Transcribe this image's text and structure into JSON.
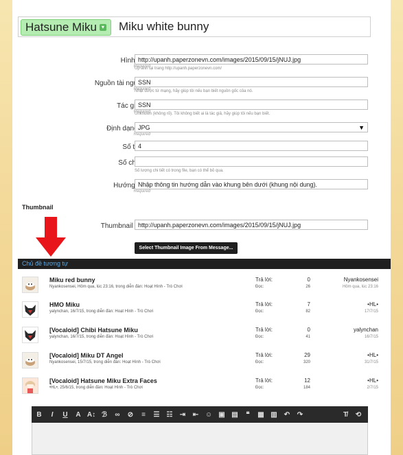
{
  "title_row": {
    "prefix_label": "Hatsune Miku",
    "title_value": "Miku white bunny"
  },
  "form": {
    "image": {
      "label": "Hình ảnh:",
      "required": "Required",
      "value": "http://upanh.paperzonevn.com/images/2015/09/15/jNUJ.jpg",
      "hint": "Up ảnh tại trang http://upanh.paperzonevn.com/"
    },
    "source": {
      "label": "Nguồn tài nguyên:",
      "required": "Required",
      "value": "SSN",
      "hint": "Nhặt được từ mạng, hãy giúp tôi nếu bạn biết nguồn gốc của nó."
    },
    "author": {
      "label": "Tác giả vẽ:",
      "required": "Required",
      "value": "SSN",
      "hint": "Unknown (không rõ). Tôi không biết ai là tác giả, hãy giúp tôi nếu bạn biết."
    },
    "format": {
      "label": "Định dạng file:",
      "required": "Required",
      "value": "JPG"
    },
    "pages": {
      "label": "Số trang:",
      "value": "4"
    },
    "details": {
      "label": "Số chi tiết:",
      "value": "",
      "hint": "Số lượng chi tiết có trong file, bạn có thể bỏ qua."
    },
    "guide": {
      "label": "Hướng dẫn:",
      "required": "Required",
      "value": "Nhập thông tin hướng dẫn vào khung bên dưới (khung nội dung)."
    },
    "thumbnail_heading": "Thumbnail",
    "thumbnail_url": {
      "label": "Thumbnail URL:",
      "value": "http://upanh.paperzonevn.com/images/2015/09/15/jNUJ.jpg"
    },
    "select_thumb_button": "Select Thumbnail Image From Message..."
  },
  "similar": {
    "heading": "Chủ đề tương tự",
    "reply_label": "Trả lời:",
    "views_label": "Đọc:",
    "threads": [
      {
        "title": "Miku red bunny",
        "meta": "Nyankosensei, Hôm qua, lúc 23:16, trong diễn đàn: Hoạt Hình - Trò Chơi",
        "replies": "0",
        "views": "26",
        "user": "Nyankosensei",
        "date": "Hôm qua, lúc 23:16",
        "avatar": "cup-icon"
      },
      {
        "title": "HMO Miku",
        "meta": "yalynchan, 16/7/15, trong diễn đàn: Hoạt Hình - Trò Chơi",
        "replies": "7",
        "views": "82",
        "user": "•HL•",
        "date": "17/7/15",
        "avatar": "wolf-icon"
      },
      {
        "title": "[Vocaloid] Chibi Hatsune Miku",
        "meta": "yalynchan, 16/7/15, trong diễn đàn: Hoạt Hình - Trò Chơi",
        "replies": "0",
        "views": "41",
        "user": "yalynchan",
        "date": "16/7/15",
        "avatar": "wolf-icon"
      },
      {
        "title": "[Vocaloid] Miku DT Angel",
        "meta": "Nyankosensei, 15/7/15, trong diễn đàn: Hoạt Hình - Trò Chơi",
        "replies": "29",
        "views": "320",
        "user": "•HL•",
        "date": "31/7/15",
        "avatar": "cup-icon"
      },
      {
        "title": "[Vocaloid] Hatsune Miku Extra Faces",
        "meta": "•HL•, 25/6/15, trong diễn đàn: Hoạt Hình - Trò Chơi",
        "replies": "12",
        "views": "184",
        "user": "•HL•",
        "date": "2/7/15",
        "avatar": "anime-girl-icon"
      }
    ]
  },
  "colors": {
    "prefix_bg": "#b4ecb2",
    "dark_bar": "#202020",
    "heading_blue": "#5aa9e6",
    "arrow_red": "#e8161b"
  }
}
